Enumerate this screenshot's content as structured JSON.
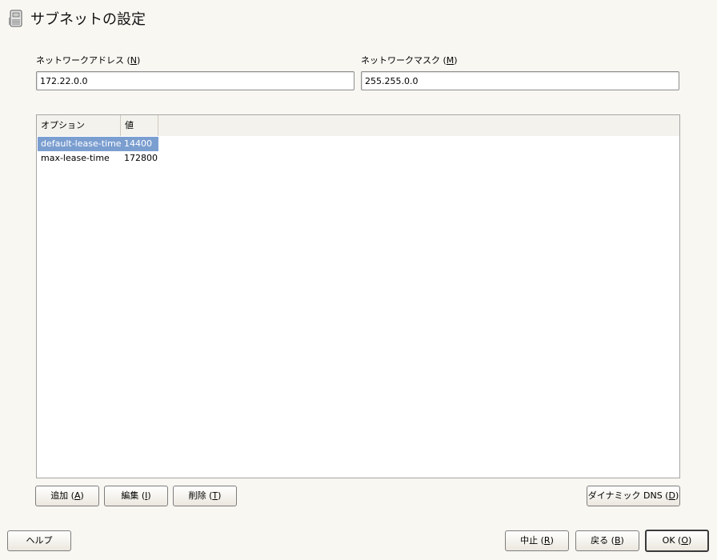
{
  "window": {
    "title": "サブネットの設定"
  },
  "network_address": {
    "label": "ネットワークアドレス",
    "mnemonic": "N",
    "value": "172.22.0.0"
  },
  "network_mask": {
    "label": "ネットワークマスク",
    "mnemonic": "M",
    "value": "255.255.0.0"
  },
  "options_table": {
    "columns": [
      "オプション",
      "値"
    ],
    "rows": [
      {
        "option": "default-lease-time",
        "value": "14400",
        "selected": true
      },
      {
        "option": "max-lease-time",
        "value": "172800",
        "selected": false
      }
    ]
  },
  "table_buttons": {
    "add": {
      "label": "追加",
      "mnemonic": "A"
    },
    "edit": {
      "label": "編集",
      "mnemonic": "I"
    },
    "delete": {
      "label": "削除",
      "mnemonic": "T"
    },
    "dynamic_dns": {
      "label": "ダイナミック DNS",
      "mnemonic": "D"
    }
  },
  "footer": {
    "help": {
      "label": "ヘルプ"
    },
    "abort": {
      "label": "中止",
      "mnemonic": "R"
    },
    "back": {
      "label": "戻る",
      "mnemonic": "B"
    },
    "ok": {
      "label": "OK",
      "mnemonic": "O"
    }
  },
  "colors": {
    "selection": "#7b9ed0",
    "background": "#f9f7f2"
  }
}
